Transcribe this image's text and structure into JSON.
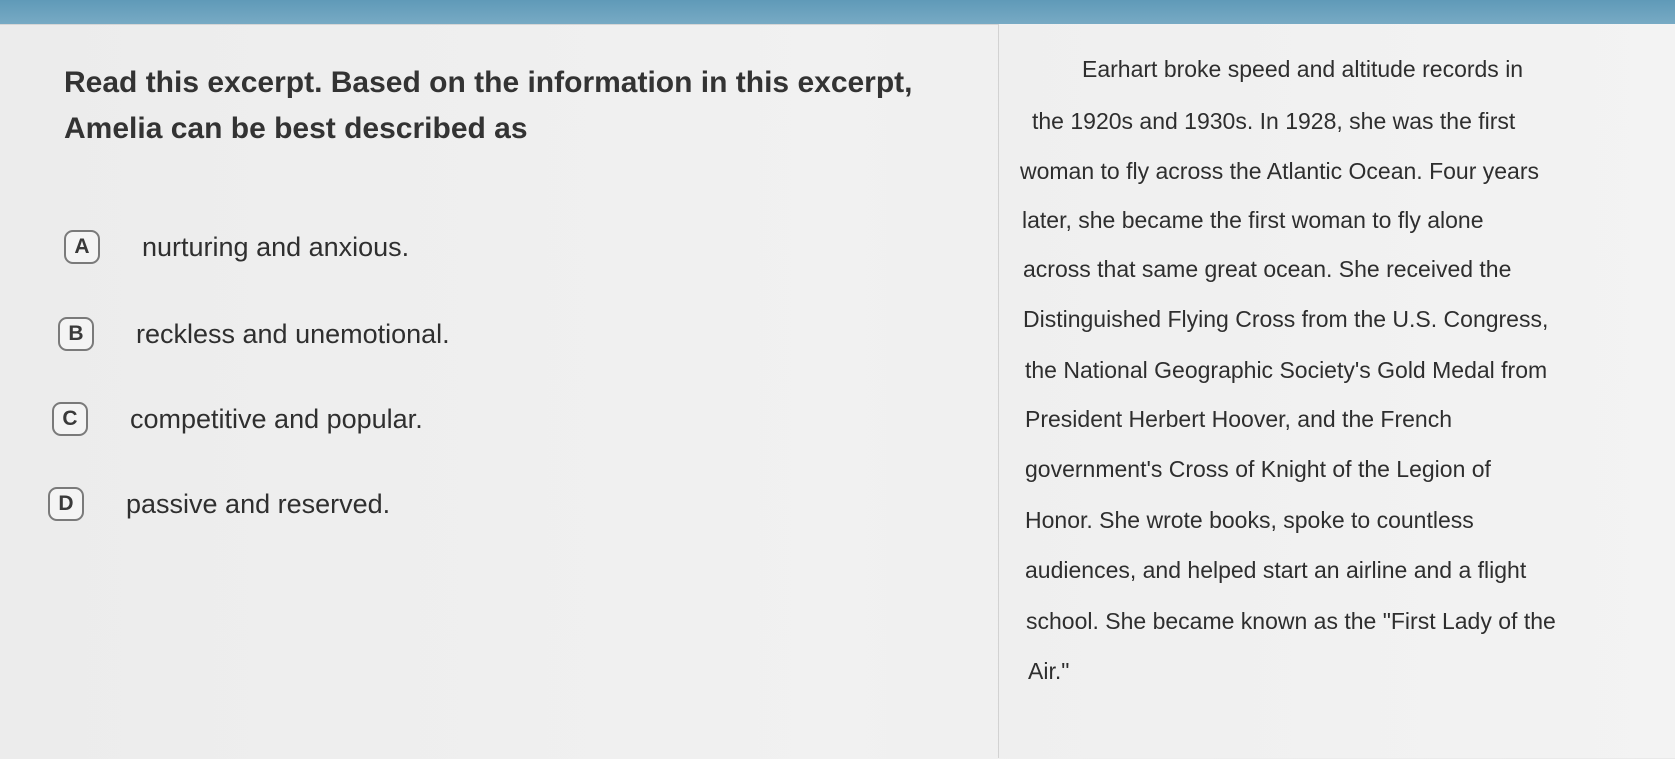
{
  "question": {
    "text": "Read this excerpt. Based on the information in this excerpt, Amelia can be best described as"
  },
  "choices": [
    {
      "letter": "A",
      "label": "nurturing and anxious."
    },
    {
      "letter": "B",
      "label": "reckless and unemotional."
    },
    {
      "letter": "C",
      "label": "competitive and popular."
    },
    {
      "letter": "D",
      "label": "passive and reserved."
    }
  ],
  "passage": {
    "lines": [
      "Earhart broke speed and altitude records in",
      "the 1920s and 1930s. In 1928, she was the first",
      "woman to fly across the Atlantic Ocean. Four years",
      "later, she became the first woman to fly alone",
      "across that same great ocean. She received the",
      "Distinguished Flying Cross from the U.S. Congress,",
      "the National Geographic Society's Gold Medal from",
      "President Herbert Hoover, and the French",
      "government's Cross of Knight of the Legion of",
      "Honor. She wrote books, spoke to countless",
      "audiences, and helped start an airline and a flight",
      "school. She became known as the \"First Lady of the",
      "Air.\""
    ]
  }
}
